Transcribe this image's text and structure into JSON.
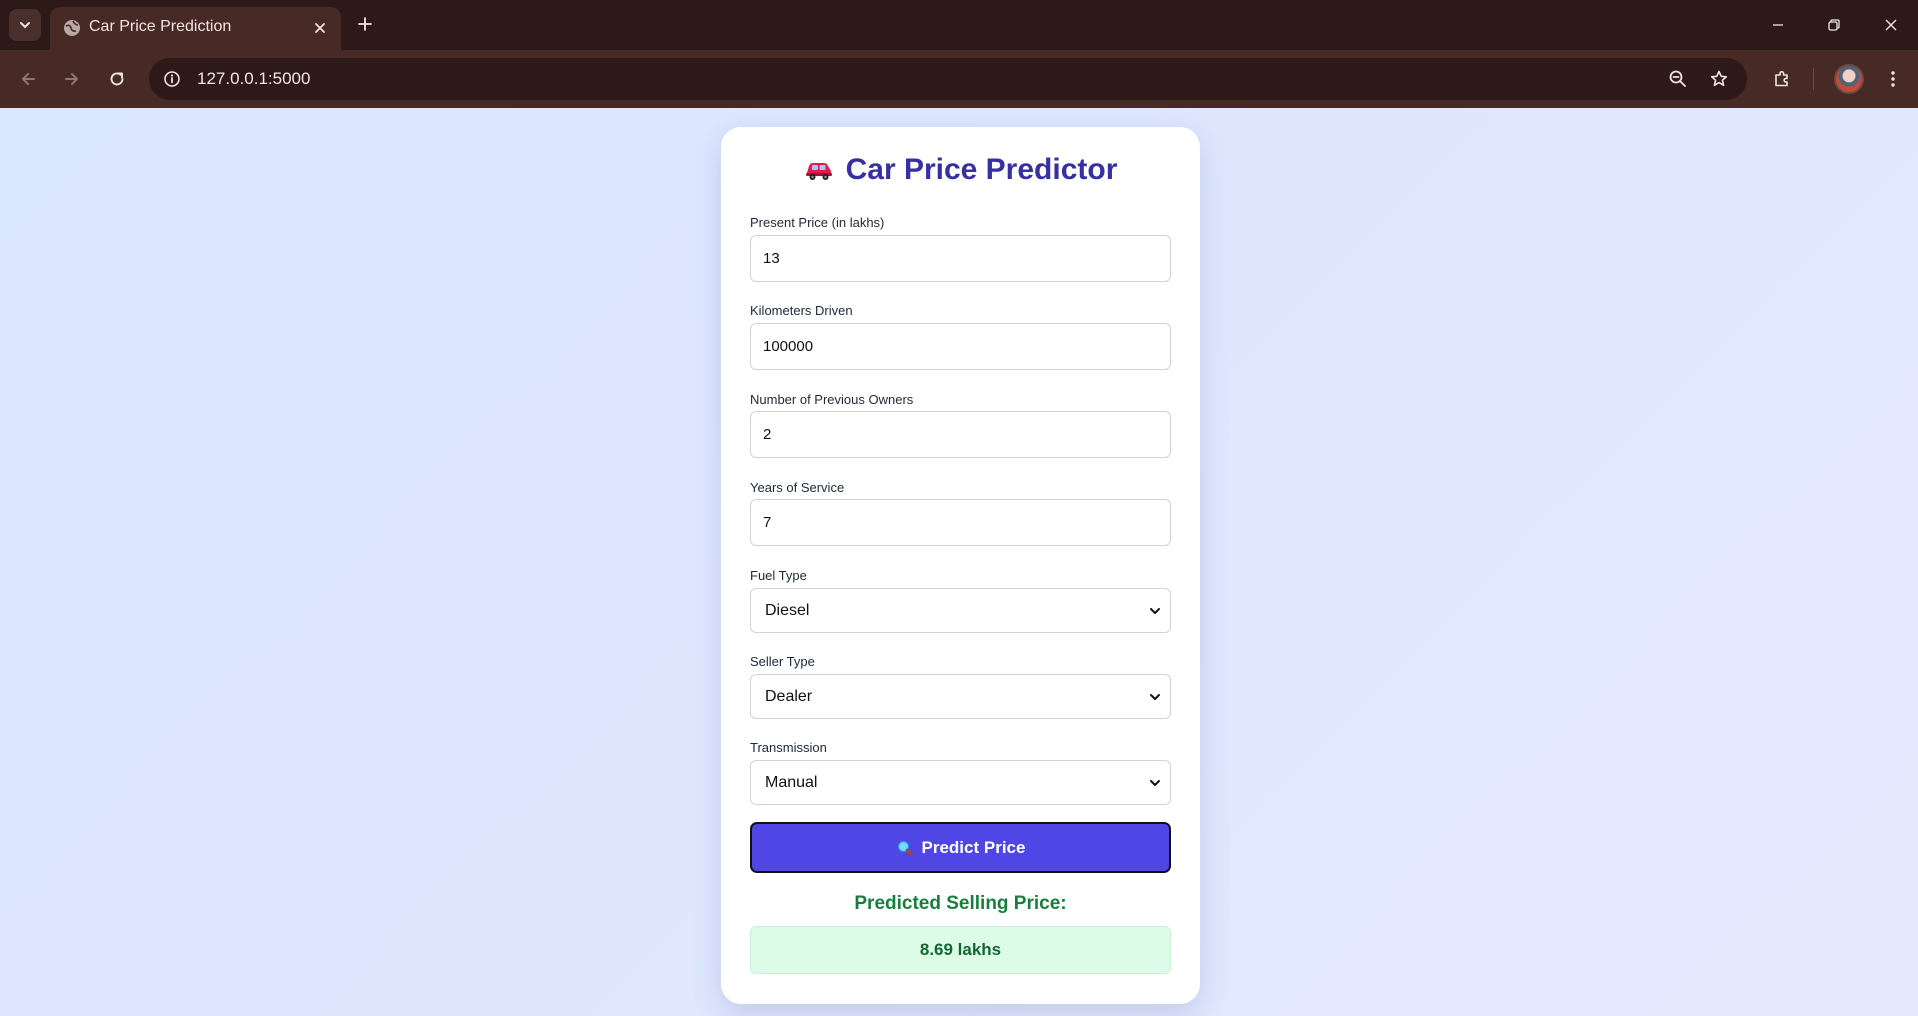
{
  "browser": {
    "tab_title": "Car Price Prediction",
    "url": "127.0.0.1:5000"
  },
  "app": {
    "title": "Car Price Predictor",
    "title_icon": "car-icon",
    "fields": {
      "present_price": {
        "label": "Present Price (in lakhs)",
        "value": "13"
      },
      "kms_driven": {
        "label": "Kilometers Driven",
        "value": "100000"
      },
      "owners": {
        "label": "Number of Previous Owners",
        "value": "2"
      },
      "years": {
        "label": "Years of Service",
        "value": "7"
      },
      "fuel_type": {
        "label": "Fuel Type",
        "value": "Diesel"
      },
      "seller_type": {
        "label": "Seller Type",
        "value": "Dealer"
      },
      "transmission": {
        "label": "Transmission",
        "value": "Manual"
      }
    },
    "predict_button": {
      "label": "Predict Price",
      "icon": "magnifier-icon"
    },
    "result": {
      "heading": "Predicted Selling Price:",
      "value": "8.69 lakhs"
    }
  },
  "colors": {
    "accent": "#4f46e5",
    "title": "#3730a3",
    "result_text": "#15803d",
    "result_bg": "#dcfce7"
  }
}
